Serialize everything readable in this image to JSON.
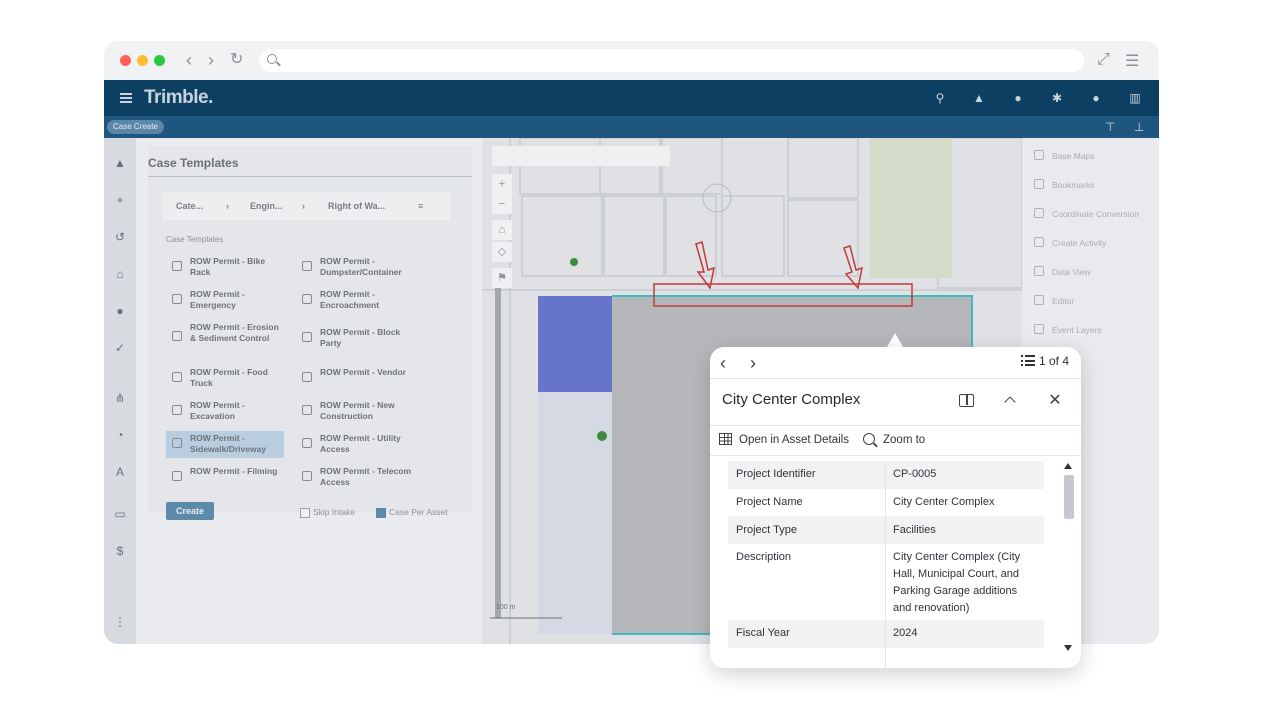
{
  "topbar": {
    "brand": "Trimble."
  },
  "subbar": {
    "case_create_label": "Case Create"
  },
  "panel": {
    "title": "Case Templates",
    "breadcrumbs": [
      "Cate...",
      "Engin...",
      "Right of Wa..."
    ],
    "section_label": "Case Templates",
    "templates": [
      "ROW Permit - Bike Rack",
      "ROW Permit - Dumpster/Container",
      "ROW Permit - Emergency",
      "ROW Permit - Encroachment",
      "ROW Permit - Erosion & Sediment Control",
      "ROW Permit - Block Party",
      "ROW Permit - Food Truck",
      "ROW Permit - Vendor",
      "ROW Permit - Excavation",
      "ROW Permit - New Construction",
      "ROW Permit - Sidewalk/Driveway",
      "ROW Permit - Utility Access",
      "ROW Permit - Filming",
      "ROW Permit - Telecom Access"
    ],
    "create_label": "Create",
    "skip_intake_label": "Skip Intake",
    "case_per_asset_label": "Case Per Asset"
  },
  "map": {
    "zoom_in": "+",
    "zoom_out": "−",
    "scale_label": "100 m"
  },
  "right_panel": {
    "items": [
      "Base Maps",
      "Bookmarks",
      "Coordinate Conversion",
      "Create Activity",
      "Data View",
      "Editor",
      "Event Layers"
    ]
  },
  "popup": {
    "count_text": "1 of 4",
    "title": "City Center Complex",
    "open_asset_label": "Open in Asset Details",
    "zoom_to_label": "Zoom to",
    "rows": [
      {
        "key": "Project Identifier",
        "value": "CP-0005"
      },
      {
        "key": "Project Name",
        "value": "City Center Complex"
      },
      {
        "key": "Project Type",
        "value": "Facilities"
      },
      {
        "key": "Description",
        "value": "City Center Complex (City Hall, Municipal Court, and Parking Garage additions and renovation)"
      },
      {
        "key": "Fiscal Year",
        "value": "2024"
      }
    ]
  },
  "colors": {
    "topbar": "#0d3f63",
    "subbar": "#1f5680",
    "highlight_blue": "#5061c8",
    "annotation_red": "#c23a3a",
    "teal_outline": "#3fb9c4"
  }
}
